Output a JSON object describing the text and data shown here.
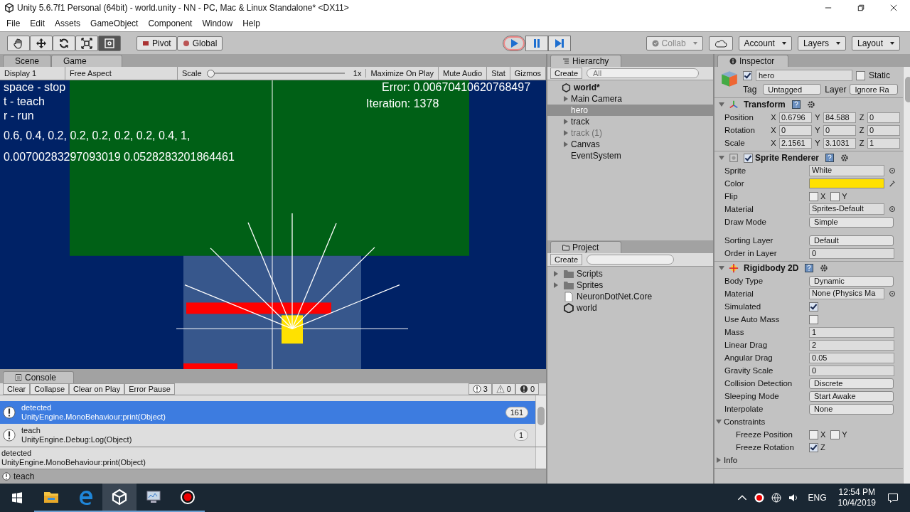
{
  "window": {
    "title": "Unity 5.6.7f1 Personal (64bit) - world.unity - NN - PC, Mac & Linux Standalone* <DX11>"
  },
  "menu": [
    "File",
    "Edit",
    "Assets",
    "GameObject",
    "Component",
    "Window",
    "Help"
  ],
  "toolbar": {
    "tools": [
      {
        "kind": "hand",
        "selected": false
      },
      {
        "kind": "move",
        "selected": false
      },
      {
        "kind": "rotate",
        "selected": false
      },
      {
        "kind": "scale",
        "selected": false
      },
      {
        "kind": "rect",
        "selected": true
      }
    ],
    "pivot": "Pivot",
    "space": "Global",
    "playback": [
      {
        "kind": "play",
        "selected": true
      },
      {
        "kind": "pause",
        "selected": false
      },
      {
        "kind": "step",
        "selected": false
      }
    ],
    "collab": "Collab",
    "account": "Account",
    "layers": "Layers",
    "layout": "Layout"
  },
  "view_tabs": [
    {
      "label": "Scene",
      "selected": false
    },
    {
      "label": "Game",
      "selected": true
    }
  ],
  "game_toolbar": {
    "display": "Display 1",
    "aspect": "Free Aspect",
    "scale_label": "Scale",
    "scale": {
      "level": 0.0
    },
    "scale_value": "1x",
    "buttons": [
      "Maximize On Play",
      "Mute Audio",
      "Stat"
    ],
    "gizmos": "Gizmos"
  },
  "game_view": {
    "help_lines": [
      "space - stop",
      "t - teach",
      "r - run"
    ],
    "weights": "0.6, 0.4, 0.2, 0.2, 0.2, 0.2, 0.2, 0.4, 1,",
    "outputs": "0.00700283297093019 0.0528283201864461",
    "error": "Error: 0.00670410620768497",
    "iteration": "Iteration: 1378"
  },
  "hierarchy": {
    "title": "Hierarchy",
    "create": "Create",
    "search_placeholder": "All",
    "scene": "world*",
    "items": [
      {
        "name": "Main Camera",
        "expandable": true,
        "selected": false,
        "active": true
      },
      {
        "name": "hero",
        "expandable": false,
        "selected": true,
        "active": true
      },
      {
        "name": "track",
        "expandable": true,
        "selected": false,
        "active": true
      },
      {
        "name": "track (1)",
        "expandable": true,
        "selected": false,
        "active": false
      },
      {
        "name": "Canvas",
        "expandable": true,
        "selected": false,
        "active": true
      },
      {
        "name": "EventSystem",
        "expandable": false,
        "selected": false,
        "active": true
      }
    ]
  },
  "project": {
    "title": "Project",
    "create": "Create",
    "items": [
      {
        "name": "Scripts",
        "kind": "folder"
      },
      {
        "name": "Sprites",
        "kind": "folder"
      },
      {
        "name": "NeuronDotNet.Core",
        "kind": "file"
      },
      {
        "name": "world",
        "kind": "scene"
      }
    ]
  },
  "inspector": {
    "title": "Inspector",
    "object_name": "hero",
    "active": true,
    "static_label": "Static",
    "static": false,
    "tag_label": "Tag",
    "tag": "Untagged",
    "layer_label": "Layer",
    "layer": "Ignore Ra",
    "components": [
      {
        "name": "Transform",
        "kind": "transform",
        "rows": [
          {
            "kind": "vector",
            "label": "Position",
            "axes": [
              {
                "axis": "X",
                "value": "0.6796"
              },
              {
                "axis": "Y",
                "value": "84.588"
              },
              {
                "axis": "Z",
                "value": "0"
              }
            ]
          },
          {
            "kind": "vector",
            "label": "Rotation",
            "axes": [
              {
                "axis": "X",
                "value": "0"
              },
              {
                "axis": "Y",
                "value": "0"
              },
              {
                "axis": "Z",
                "value": "0"
              }
            ]
          },
          {
            "kind": "vector",
            "label": "Scale",
            "axes": [
              {
                "axis": "X",
                "value": "2.1561"
              },
              {
                "axis": "Y",
                "value": "3.1031"
              },
              {
                "axis": "Z",
                "value": "1"
              }
            ]
          }
        ]
      },
      {
        "name": "Sprite Renderer",
        "kind": "sprite",
        "enabled": true,
        "rows": [
          {
            "kind": "object",
            "label": "Sprite",
            "value": "White"
          },
          {
            "kind": "color",
            "label": "Color",
            "color": "#ffe100"
          },
          {
            "kind": "toggles",
            "label": "Flip",
            "axes": [
              {
                "axis": "X",
                "checked": false
              },
              {
                "axis": "Y",
                "checked": false
              }
            ]
          },
          {
            "kind": "object",
            "label": "Material",
            "value": "Sprites-Default"
          },
          {
            "kind": "dropdown",
            "label": "Draw Mode",
            "value": "Simple"
          },
          {
            "kind": "dropdown",
            "label": "Sorting Layer",
            "value": "Default",
            "spaced": true
          },
          {
            "kind": "field",
            "label": "Order in Layer",
            "value": "0"
          }
        ]
      },
      {
        "name": "Rigidbody 2D",
        "kind": "rigidbody",
        "rows": [
          {
            "kind": "dropdown",
            "label": "Body Type",
            "value": "Dynamic"
          },
          {
            "kind": "object",
            "label": "Material",
            "value": "None (Physics Ma"
          },
          {
            "kind": "checkbox",
            "label": "Simulated",
            "checked": true
          },
          {
            "kind": "checkbox",
            "label": "Use Auto Mass",
            "checked": false
          },
          {
            "kind": "field",
            "label": "Mass",
            "value": "1"
          },
          {
            "kind": "field",
            "label": "Linear Drag",
            "value": "2"
          },
          {
            "kind": "field",
            "label": "Angular Drag",
            "value": "0.05"
          },
          {
            "kind": "field",
            "label": "Gravity Scale",
            "value": "0"
          },
          {
            "kind": "dropdown",
            "label": "Collision Detection",
            "value": "Discrete"
          },
          {
            "kind": "dropdown",
            "label": "Sleeping Mode",
            "value": "Start Awake"
          },
          {
            "kind": "dropdown",
            "label": "Interpolate",
            "value": "None"
          },
          {
            "kind": "foldout",
            "label": "Constraints",
            "expanded": true
          },
          {
            "kind": "toggles",
            "label": "Freeze Position",
            "nested": true,
            "axes": [
              {
                "axis": "X",
                "checked": false
              },
              {
                "axis": "Y",
                "checked": false
              }
            ]
          },
          {
            "kind": "toggles",
            "label": "Freeze Rotation",
            "nested": true,
            "axes": [
              {
                "axis": "Z",
                "checked": true
              }
            ]
          },
          {
            "kind": "foldout",
            "label": "Info",
            "expanded": false
          }
        ]
      }
    ]
  },
  "console": {
    "title": "Console",
    "buttons": [
      "Clear",
      "Collapse",
      "Clear on Play",
      "Error Pause"
    ],
    "counts": [
      {
        "kind": "info",
        "count": "3"
      },
      {
        "kind": "warning",
        "count": "0"
      },
      {
        "kind": "error",
        "count": "0"
      }
    ],
    "entries": [
      {
        "message": "detected",
        "trace": "UnityEngine.MonoBehaviour:print(Object)",
        "count": "161",
        "selected": true
      },
      {
        "message": "teach",
        "trace": "UnityEngine.Debug:Log(Object)",
        "count": "1",
        "selected": false
      }
    ],
    "detail": [
      "detected",
      "UnityEngine.MonoBehaviour:print(Object)"
    ],
    "status": "teach"
  },
  "taskbar": {
    "apps": [
      {
        "kind": "explorer",
        "active": false
      },
      {
        "kind": "edge",
        "active": false
      },
      {
        "kind": "unity",
        "active": true
      },
      {
        "kind": "monitor",
        "active": false
      },
      {
        "kind": "record",
        "active": false
      }
    ],
    "language": "ENG",
    "time": "12:54 PM",
    "date": "10/4/2019"
  }
}
